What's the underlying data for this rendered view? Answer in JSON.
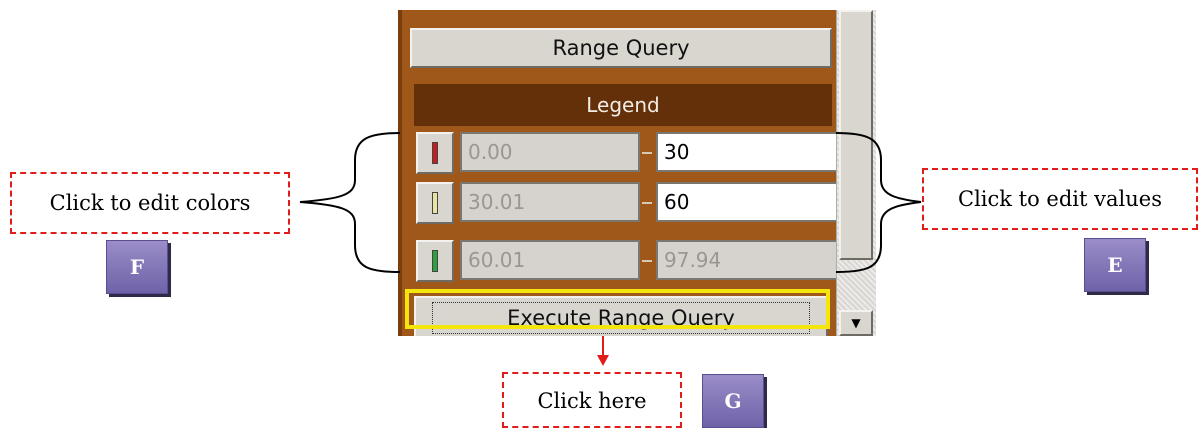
{
  "panel": {
    "range_query_label": "Range Query",
    "legend_title": "Legend",
    "rows": [
      {
        "from": "0.00",
        "to": "30",
        "color": "#c02020",
        "to_editable": true
      },
      {
        "from": "30.01",
        "to": "60",
        "color": "#e8e3a0",
        "to_editable": true
      },
      {
        "from": "60.01",
        "to": "97.94",
        "color": "#2ea040",
        "to_editable": false
      }
    ],
    "execute_label": "Execute Range Query",
    "scroll_down_glyph": "▼"
  },
  "annotations": {
    "edit_colors": "Click to edit colors",
    "edit_values": "Click to edit values",
    "click_here": "Click here",
    "badge_f": "F",
    "badge_e": "E",
    "badge_g": "G"
  },
  "colors": {
    "panel_bg": "#a0581a",
    "legend_header_bg": "#64300a",
    "highlight": "#f4e60a",
    "callout_border": "#e21b1b",
    "badge": "#7d71b4"
  }
}
